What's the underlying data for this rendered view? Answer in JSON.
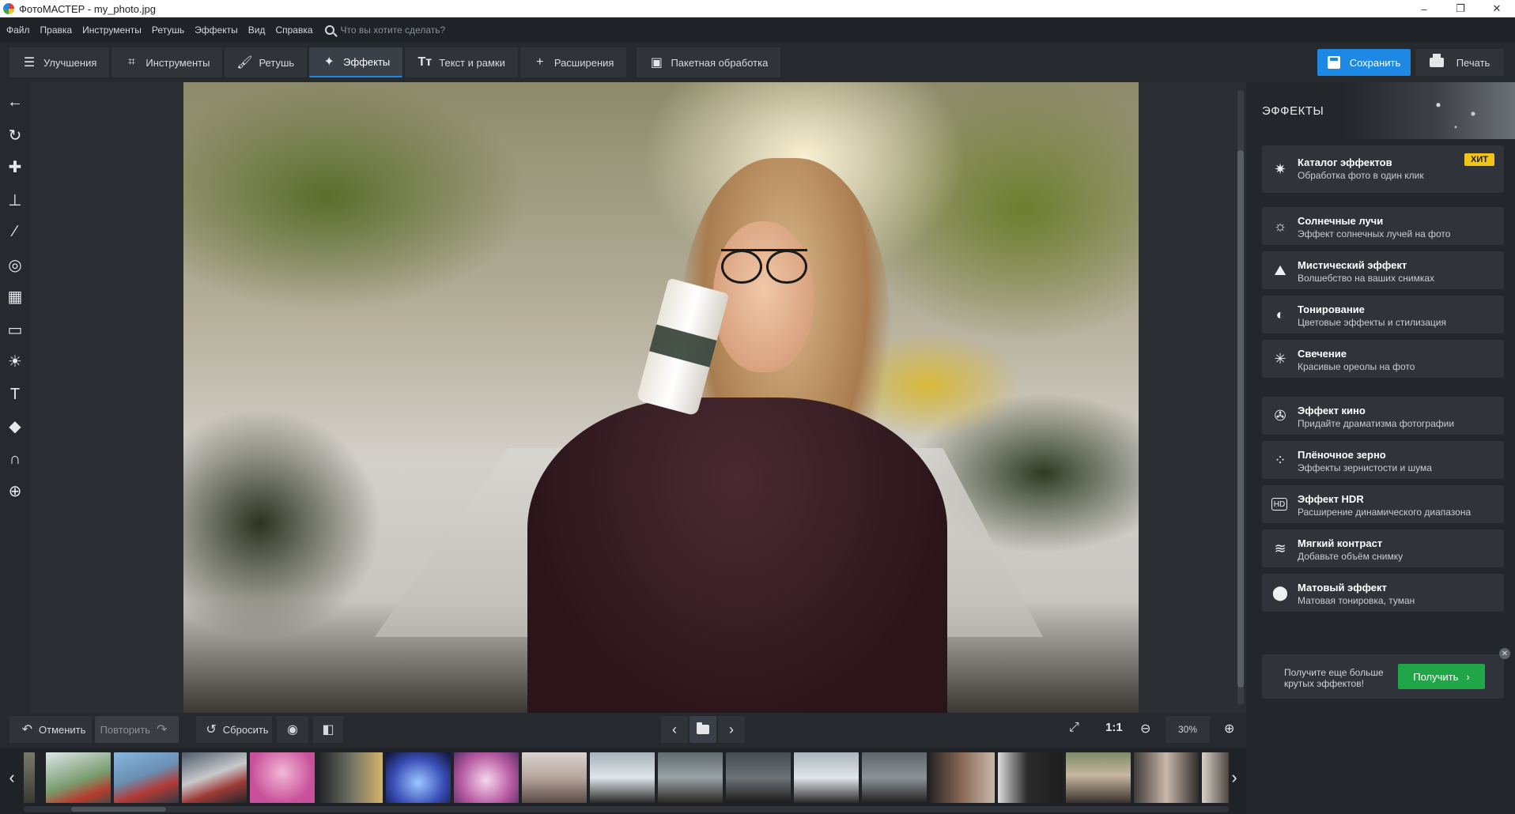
{
  "window": {
    "title": "ФотоМАСТЕР - my_photo.jpg",
    "controls": [
      "–",
      "❐",
      "✕"
    ]
  },
  "menu": {
    "items": [
      "Файл",
      "Правка",
      "Инструменты",
      "Ретушь",
      "Эффекты",
      "Вид",
      "Справка"
    ],
    "search_placeholder": "Что вы хотите сделать?"
  },
  "toolbar": {
    "tabs": [
      {
        "label": "Улучшения",
        "icon": "sliders-icon"
      },
      {
        "label": "Инструменты",
        "icon": "crop-icon"
      },
      {
        "label": "Ретушь",
        "icon": "brush-icon"
      },
      {
        "label": "Эффекты",
        "icon": "magic-wand-icon",
        "active": true
      },
      {
        "label": "Текст и рамки",
        "icon": "text-icon"
      },
      {
        "label": "Расширения",
        "icon": "plus-icon"
      },
      {
        "label": "Пакетная обработка",
        "icon": "batch-images-icon"
      }
    ],
    "save_label": "Сохранить",
    "print_label": "Печать"
  },
  "left_tools": [
    "back-arrow-icon",
    "rotate-icon",
    "healing-patch-icon",
    "stamp-icon",
    "brush-icon",
    "radial-filter-icon",
    "gradient-filter-icon",
    "vignette-icon",
    "light-icon",
    "text-tool-icon",
    "fill-bucket-icon",
    "person-shape-icon",
    "liquify-icon"
  ],
  "effects_panel": {
    "title": "ЭФФЕКТЫ",
    "catalog": {
      "title": "Каталог эффектов",
      "subtitle": "Обработка фото в один клик",
      "badge": "ХИТ"
    },
    "group1": [
      {
        "title": "Солнечные лучи",
        "subtitle": "Эффект солнечных лучей на фото"
      },
      {
        "title": "Мистический эффект",
        "subtitle": "Волшебство на ваших снимках"
      },
      {
        "title": "Тонирование",
        "subtitle": "Цветовые эффекты и стилизация"
      },
      {
        "title": "Свечение",
        "subtitle": "Красивые ореолы на фото"
      }
    ],
    "group2": [
      {
        "title": "Эффект кино",
        "subtitle": "Придайте драматизма фотографии"
      },
      {
        "title": "Плёночное зерно",
        "subtitle": "Эффекты зернистости и шума"
      },
      {
        "title": "Эффект HDR",
        "subtitle": "Расширение динамического диапазона"
      },
      {
        "title": "Мягкий контраст",
        "subtitle": "Добавьте объём снимку"
      },
      {
        "title": "Матовый эффект",
        "subtitle": "Матовая тонировка, туман"
      }
    ],
    "promo": {
      "text": "Получите еще больше крутых эффектов!",
      "button": "Получить"
    }
  },
  "bottom": {
    "undo_label": "Отменить",
    "redo_label": "Повторить",
    "reset_label": "Сбросить",
    "zoom_one_to_one": "1:1",
    "zoom_value": "30%"
  },
  "colors": {
    "accent": "#1e88e5",
    "badge": "#f2c318",
    "get_button": "#20a648"
  }
}
